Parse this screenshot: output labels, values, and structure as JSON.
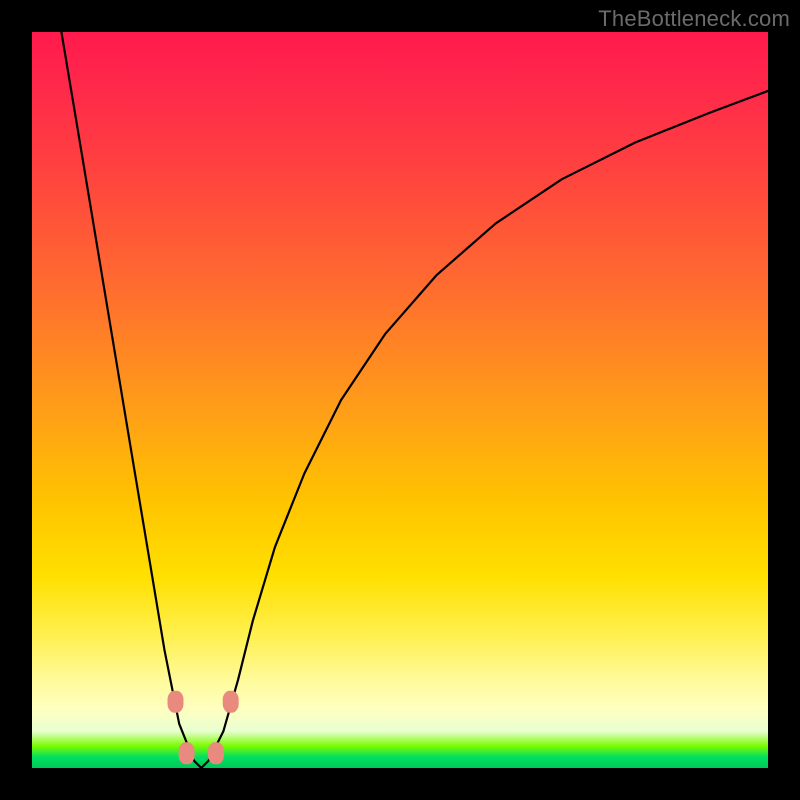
{
  "watermark": "TheBottleneck.com",
  "chart_data": {
    "type": "line",
    "title": "",
    "xlabel": "",
    "ylabel": "",
    "xlim": [
      0,
      100
    ],
    "ylim": [
      0,
      100
    ],
    "grid": false,
    "series": [
      {
        "name": "bottleneck-curve",
        "x": [
          4,
          6,
          8,
          10,
          12,
          14,
          16,
          18,
          20,
          22,
          23,
          24,
          26,
          28,
          30,
          33,
          37,
          42,
          48,
          55,
          63,
          72,
          82,
          92,
          100
        ],
        "y": [
          100,
          88,
          76,
          64,
          52,
          40,
          28,
          16,
          6,
          1,
          0,
          1,
          5,
          12,
          20,
          30,
          40,
          50,
          59,
          67,
          74,
          80,
          85,
          89,
          92
        ]
      }
    ],
    "markers": [
      {
        "name": "valley-marker-left-upper",
        "x": 19.5,
        "y": 9
      },
      {
        "name": "valley-marker-left-lower",
        "x": 21.0,
        "y": 2
      },
      {
        "name": "valley-marker-right-lower",
        "x": 25.0,
        "y": 2
      },
      {
        "name": "valley-marker-right-upper",
        "x": 27.0,
        "y": 9
      }
    ],
    "colors": {
      "curve": "#000000",
      "marker_fill": "#e98a7f",
      "gradient_top": "#ff1a4d",
      "gradient_bottom": "#00c85a"
    }
  }
}
